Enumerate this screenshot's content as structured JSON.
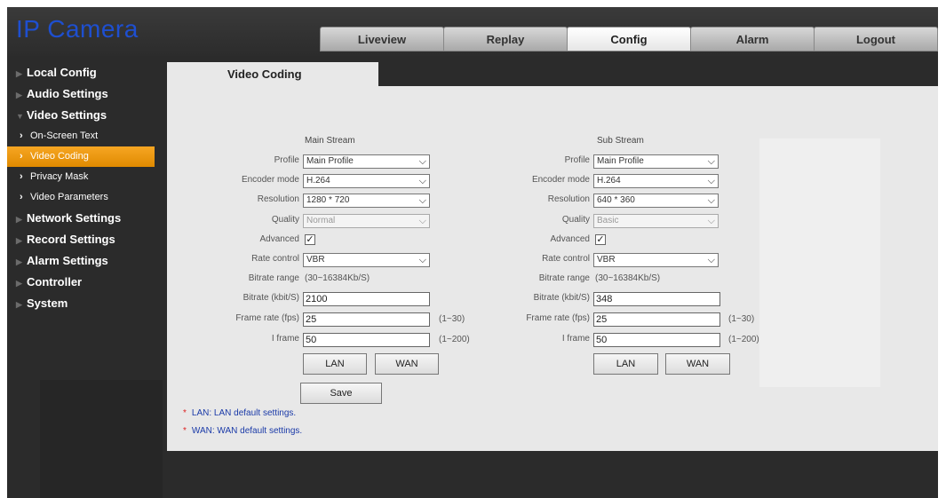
{
  "app": {
    "title": "IP Camera"
  },
  "tabs": [
    {
      "label": "Liveview"
    },
    {
      "label": "Replay"
    },
    {
      "label": "Config"
    },
    {
      "label": "Alarm"
    },
    {
      "label": "Logout"
    }
  ],
  "active_tab": "Config",
  "sidebar": {
    "items": [
      {
        "label": "Local Config"
      },
      {
        "label": "Audio Settings"
      },
      {
        "label": "Video Settings"
      },
      {
        "label": "Network Settings"
      },
      {
        "label": "Record Settings"
      },
      {
        "label": "Alarm Settings"
      },
      {
        "label": "Controller"
      },
      {
        "label": "System"
      }
    ],
    "video_sub": [
      {
        "label": "On-Screen Text"
      },
      {
        "label": "Video Coding"
      },
      {
        "label": "Privacy Mask"
      },
      {
        "label": "Video Parameters"
      }
    ]
  },
  "page": {
    "tab_title": "Video Coding"
  },
  "labels": {
    "profile": "Profile",
    "encoder": "Encoder mode",
    "resolution": "Resolution",
    "quality": "Quality",
    "advanced": "Advanced",
    "rate_control": "Rate control",
    "bitrate_range": "Bitrate range",
    "bitrate": "Bitrate (kbit/S)",
    "frame_rate": "Frame rate (fps)",
    "iframe": "I frame"
  },
  "main": {
    "title": "Main Stream",
    "profile": "Main Profile",
    "encoder": "H.264",
    "resolution": "1280 * 720",
    "quality": "Normal",
    "rate_control": "VBR",
    "bitrate_range": "(30~16384Kb/S)",
    "bitrate": "2100",
    "frame_rate": "25",
    "frame_rate_range": "(1~30)",
    "iframe": "50",
    "iframe_range": "(1~200)",
    "lan": "LAN",
    "wan": "WAN"
  },
  "sub": {
    "title": "Sub Stream",
    "profile": "Main Profile",
    "encoder": "H.264",
    "resolution": "640 * 360",
    "quality": "Basic",
    "rate_control": "VBR",
    "bitrate_range": "(30~16384Kb/S)",
    "bitrate": "348",
    "frame_rate": "25",
    "frame_rate_range": "(1~30)",
    "iframe": "50",
    "iframe_range": "(1~200)",
    "lan": "LAN",
    "wan": "WAN"
  },
  "save_label": "Save",
  "notes": [
    {
      "text": "LAN: LAN default settings."
    },
    {
      "text": "WAN: WAN default settings."
    }
  ],
  "colors": {
    "accent": "#f6a623",
    "logo": "#1e4fd0",
    "note": "#1a3aa8"
  },
  "icons": {
    "dropdown": "chevron-down-icon",
    "menu_arrow": "triangle-right-icon",
    "check": "check-icon"
  }
}
